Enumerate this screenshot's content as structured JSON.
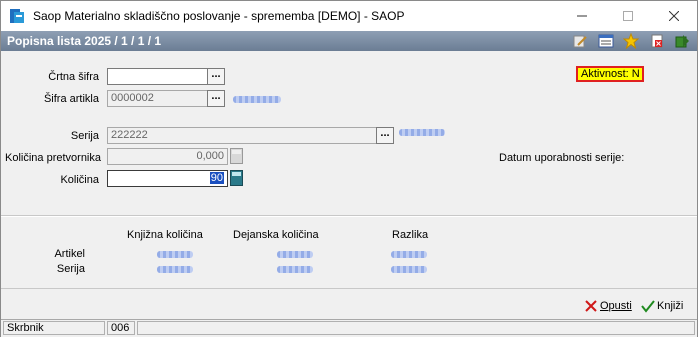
{
  "window": {
    "title": "Saop Materialno skladiščno poslovanje - sprememba [DEMO] - SAOP",
    "minimize_icon": "minimize-icon",
    "maximize_icon": "maximize-icon",
    "close_icon": "close-icon"
  },
  "header": {
    "title": "Popisna lista 2025 / 1 / 1 / 1",
    "toolbar_icons": [
      "edit-icon",
      "list-icon",
      "star-icon",
      "delete-icon",
      "exit-icon"
    ]
  },
  "form": {
    "crtna_sifra": {
      "label": "Črtna šifra",
      "value": ""
    },
    "sifra_artikla": {
      "label": "Šifra artikla",
      "value": "0000002"
    },
    "serija": {
      "label": "Serija",
      "value": "222222"
    },
    "kolicina_pretvornika": {
      "label": "Količina pretvornika",
      "value": "0,000"
    },
    "kolicina": {
      "label": "Količina",
      "value": "90"
    },
    "aktivnost": "Aktivnost:  N",
    "datum_label": "Datum uporabnosti serije:"
  },
  "summary": {
    "columns": [
      "Knjižna količina",
      "Dejanska količina",
      "Razlika"
    ],
    "rows": [
      "Artikel",
      "Serija"
    ]
  },
  "actions": {
    "cancel": "Opusti",
    "save": "Knjiži"
  },
  "statusbar": {
    "user": "Skrbnik",
    "code": "006"
  },
  "colors": {
    "header_band": "#7b8ca2",
    "aktivnost_bg": "#ffff00",
    "aktivnost_border": "#e02020"
  }
}
